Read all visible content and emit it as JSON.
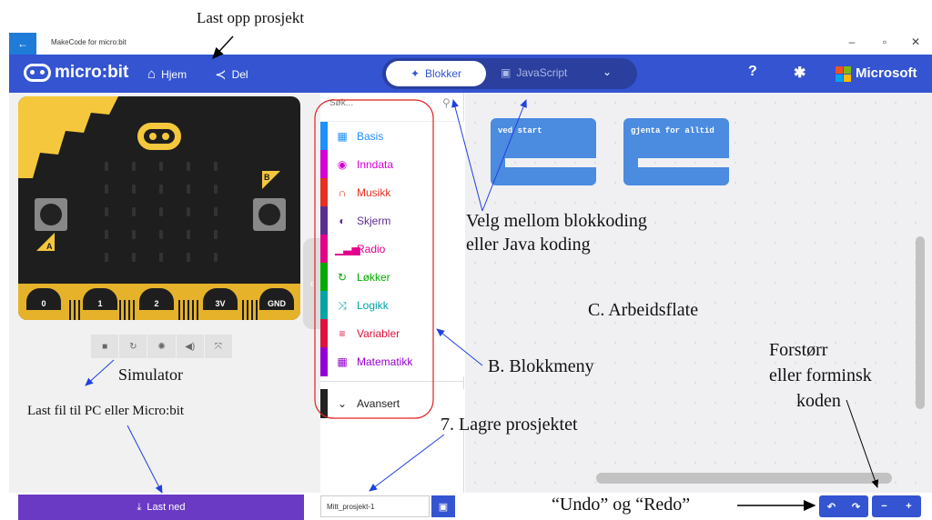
{
  "window": {
    "title": "MakeCode for micro:bit",
    "back_icon": "arrow-left-icon",
    "minimize": "–",
    "maximize": "▫",
    "close": "✕"
  },
  "header": {
    "logo_text": "micro:bit",
    "home_label": "Hjem",
    "share_label": "Del",
    "mode_blocks_label": "Blokker",
    "mode_js_label": "JavaScript",
    "brand_label": "Microsoft",
    "colors": {
      "bar": "#3454d1",
      "ms": [
        "#f25022",
        "#7fba00",
        "#00a4ef",
        "#ffb900"
      ]
    }
  },
  "simulator": {
    "pins": [
      "0",
      "1",
      "2",
      "3V",
      "GND"
    ],
    "button_a": "A",
    "button_b": "B",
    "toolbar_icons": [
      "stop-icon",
      "restart-icon",
      "slowmo-icon",
      "sound-icon",
      "fullscreen-icon"
    ]
  },
  "toolbox": {
    "search_placeholder": "Søk...",
    "categories": [
      {
        "label": "Basis",
        "color": "#1e90ff",
        "icon": "grid-icon",
        "glyph": "▦"
      },
      {
        "label": "Inndata",
        "color": "#d400d4",
        "icon": "input-icon",
        "glyph": "◉"
      },
      {
        "label": "Musikk",
        "color": "#e63022",
        "icon": "headphones-icon",
        "glyph": "∩"
      },
      {
        "label": "Skjerm",
        "color": "#5c2d91",
        "icon": "toggle-icon",
        "glyph": "◐"
      },
      {
        "label": "Radio",
        "color": "#e3008c",
        "icon": "signal-icon",
        "glyph": "▁▃▅"
      },
      {
        "label": "Løkker",
        "color": "#00aa00",
        "icon": "loop-icon",
        "glyph": "↻"
      },
      {
        "label": "Logikk",
        "color": "#00a4a6",
        "icon": "shuffle-icon",
        "glyph": "⤨"
      },
      {
        "label": "Variabler",
        "color": "#dc143c",
        "icon": "lines-icon",
        "glyph": "≡"
      },
      {
        "label": "Matematikk",
        "color": "#9400d3",
        "icon": "calculator-icon",
        "glyph": "▦"
      }
    ],
    "advanced_label": "Avansert"
  },
  "workspace": {
    "blocks": [
      {
        "label": "ved start"
      },
      {
        "label": "gjenta for alltid"
      }
    ]
  },
  "bottom": {
    "download_label": "Last ned",
    "project_name": "Mitt_prosjekt-1",
    "undo": "↶",
    "redo": "↷",
    "zoom_out": "−",
    "zoom_in": "+"
  },
  "annotations": {
    "upload": "Last opp prosjekt",
    "choose_mode": "Velg mellom blokkoding",
    "choose_mode_2": "eller Java koding",
    "workspace": "C. Arbeidsflate",
    "zoom_1": "Forstørr",
    "zoom_2": "eller forminsk",
    "zoom_3": "koden",
    "block_menu": "B. Blokkmeny",
    "simulator": "Simulator",
    "download": "Last fil til PC eller Micro:bit",
    "save": "7. Lagre prosjektet",
    "undo_redo": "“Undo” og “Redo”"
  }
}
